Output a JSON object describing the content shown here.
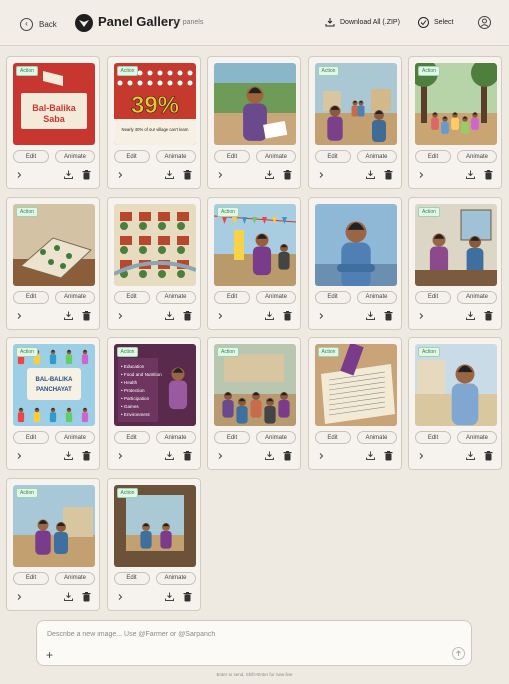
{
  "header": {
    "back_label": "Back",
    "title": "Panel Gallery",
    "count": "17 panels",
    "download_label": "Download All (.ZIP)",
    "select_label": "Select"
  },
  "card_labels": {
    "edit": "Edit",
    "animate": "Animate",
    "badge": "Action"
  },
  "panels": [
    {
      "scene": "poster",
      "badge": true,
      "poster_title": "Bal-Balika Saba"
    },
    {
      "scene": "stat",
      "badge": true,
      "stat_value": "39%",
      "stat_caption": "Nearly 40% of our village can't learn"
    },
    {
      "scene": "woman",
      "badge": false
    },
    {
      "scene": "village",
      "badge": true
    },
    {
      "scene": "kids",
      "badge": true
    },
    {
      "scene": "map_table",
      "badge": true
    },
    {
      "scene": "map",
      "badge": false
    },
    {
      "scene": "festive",
      "badge": true
    },
    {
      "scene": "man",
      "badge": false
    },
    {
      "scene": "talk",
      "badge": true
    },
    {
      "scene": "panchayat",
      "badge": true,
      "poster_title": "BAL-BALIKA PANCHAYAT"
    },
    {
      "scene": "list",
      "badge": true,
      "list_items": [
        "Education",
        "Food and Nutrition",
        "Health",
        "Protection",
        "Participation",
        "Games",
        "Environment"
      ]
    },
    {
      "scene": "group",
      "badge": true
    },
    {
      "scene": "writing",
      "badge": true
    },
    {
      "scene": "standing",
      "badge": true
    },
    {
      "scene": "walking",
      "badge": true
    },
    {
      "scene": "doorway",
      "badge": true
    }
  ],
  "prompt": {
    "placeholder": "Describe a new image... Use @Farmer or @Sarpanch",
    "hint": "Enter to send, Shift+Enter for new line"
  },
  "colors": {
    "background": "#efeae1",
    "badge_green": "#2d8a4c",
    "accent_dark": "#1f1f1f"
  }
}
